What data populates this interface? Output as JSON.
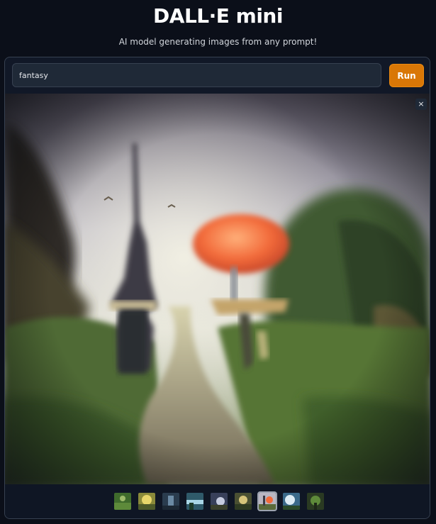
{
  "header": {
    "title": "DALL·E mini",
    "subtitle": "AI model generating images from any prompt!"
  },
  "prompt": {
    "value": "fantasy"
  },
  "run_button": {
    "label": "Run"
  },
  "close_button": {
    "label": "×",
    "icon": "close-icon"
  },
  "colors": {
    "background": "#0b0f19",
    "panel": "#111827",
    "accent": "#d97706"
  },
  "thumbnails": {
    "count": 9,
    "selected_index": 6
  }
}
